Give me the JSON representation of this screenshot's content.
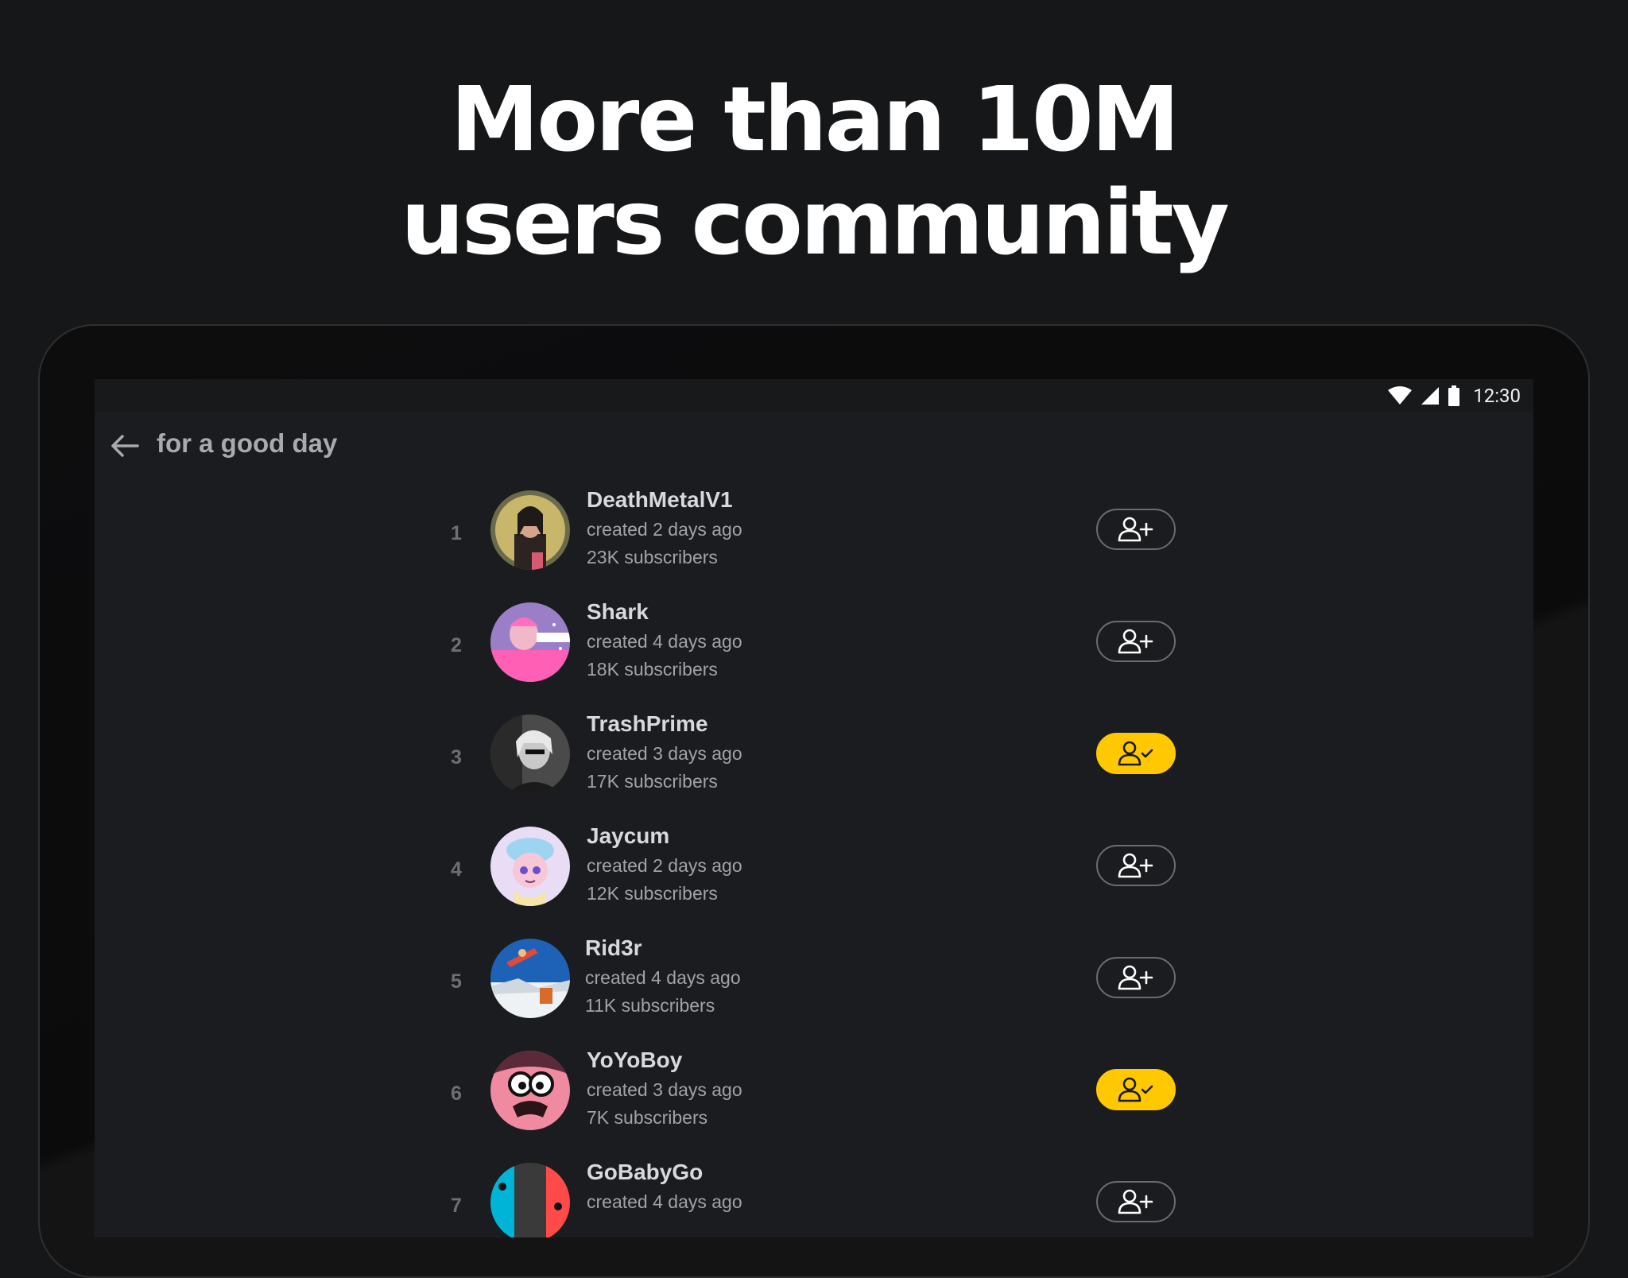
{
  "headline": {
    "line1": "More than 10M",
    "line2": "users community"
  },
  "status_bar": {
    "time": "12:30",
    "icons": [
      "wifi-icon",
      "cell-signal-icon",
      "battery-icon"
    ]
  },
  "app_bar": {
    "title": "for a good day",
    "back_icon": "arrow-left-icon"
  },
  "colors": {
    "accent": "#ffc800",
    "background": "#1a1c1f",
    "page_background": "#161718"
  },
  "users": [
    {
      "rank": "1",
      "name": "DeathMetalV1",
      "created": "created 2 days ago",
      "subscribers": "23K subscribers",
      "following": false
    },
    {
      "rank": "2",
      "name": "Shark",
      "created": "created 4 days ago",
      "subscribers": "18K subscribers",
      "following": false
    },
    {
      "rank": "3",
      "name": "TrashPrime",
      "created": "created 3 days ago",
      "subscribers": "17K subscribers",
      "following": true
    },
    {
      "rank": "4",
      "name": "Jaycum",
      "created": "created 2 days ago",
      "subscribers": "12K subscribers",
      "following": false
    },
    {
      "rank": "5",
      "name": "Rid3r",
      "created": "created 4 days ago",
      "subscribers": "11K subscribers",
      "following": false
    },
    {
      "rank": "6",
      "name": "YoYoBoy",
      "created": "created 3 days ago",
      "subscribers": "7K subscribers",
      "following": true
    },
    {
      "rank": "7",
      "name": "GoBabyGo",
      "created": "created 4 days ago",
      "subscribers": "",
      "following": false
    }
  ]
}
